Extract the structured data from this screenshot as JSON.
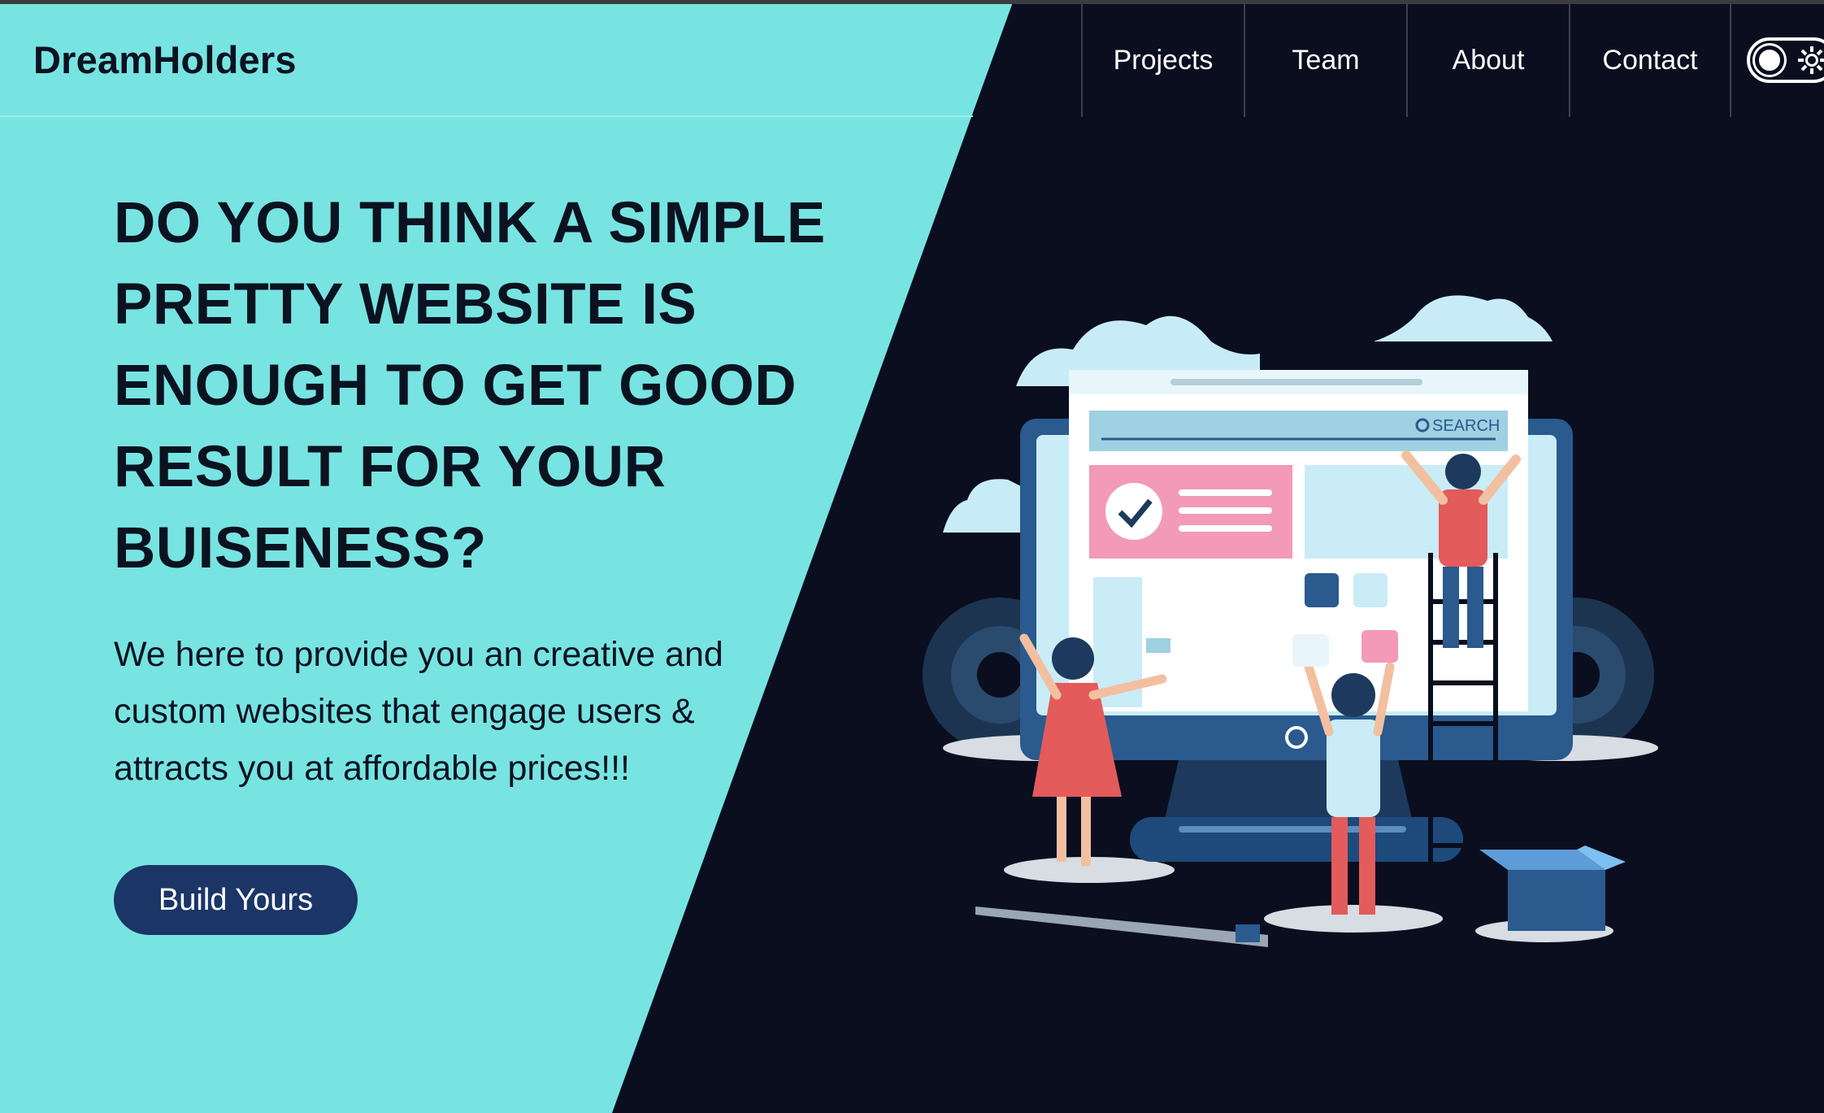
{
  "header": {
    "logo": "DreamHolders",
    "nav": [
      "Projects",
      "Team",
      "About",
      "Contact"
    ]
  },
  "theme_toggle": {
    "icon": "sun-icon",
    "state": "dark"
  },
  "hero": {
    "headline_lines": [
      "DO YOU THINK A SIMPLE",
      "PRETTY WEBSITE IS",
      "ENOUGH TO GET GOOD",
      "RESULT FOR YOUR",
      "BUISENESS?"
    ],
    "subtext_lines": [
      "We here to provide you an creative and",
      "custom websites that engage users &",
      "attracts you at affordable prices!!!"
    ],
    "cta_label": "Build Yours"
  },
  "illustration": {
    "search_label": "SEARCH"
  },
  "colors": {
    "cyan": "#77e4e2",
    "navy": "#0a0e1f",
    "button": "#1b3566",
    "text_dark": "#0b1220"
  }
}
